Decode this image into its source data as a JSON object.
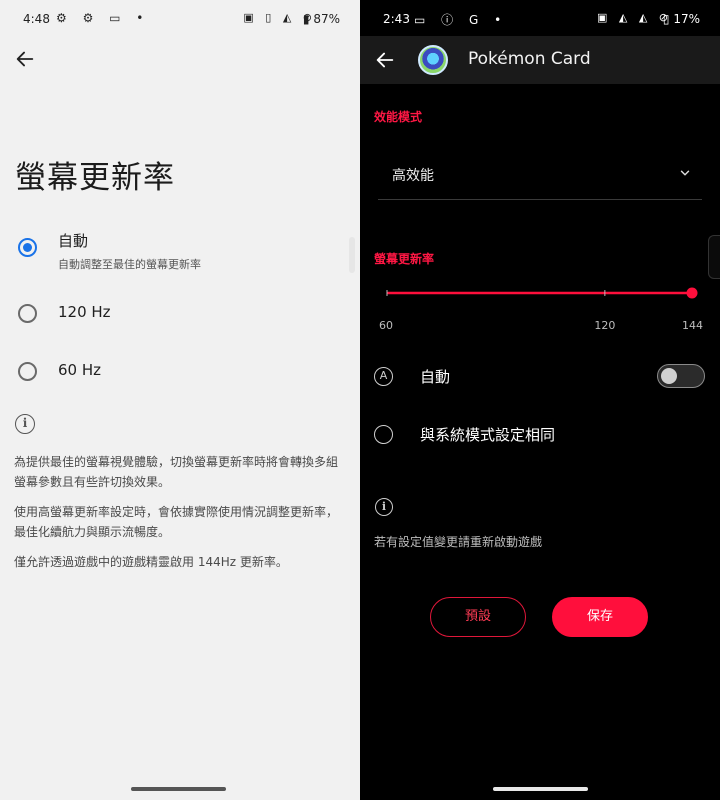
{
  "left": {
    "status": {
      "time": "4:48",
      "icons_left": "⚙ ⚙ ▭ •",
      "icons_right": "▣ ▯ ◭ ⊘",
      "battery": "▮ 87%"
    },
    "title": "螢幕更新率",
    "options": [
      {
        "label": "自動",
        "sublabel": "自動調整至最佳的螢幕更新率",
        "selected": true
      },
      {
        "label": "120 Hz",
        "sublabel": "",
        "selected": false
      },
      {
        "label": "60 Hz",
        "sublabel": "",
        "selected": false
      }
    ],
    "info_paragraphs": [
      "為提供最佳的螢幕視覺體驗，切換螢幕更新率時將會轉換多組螢幕參數且有些許切換效果。",
      "使用高螢幕更新率設定時，會依據實際使用情況調整更新率，最佳化續航力與顯示流暢度。",
      "僅允許透過遊戲中的遊戲精靈啟用 144Hz 更新率。"
    ]
  },
  "right": {
    "status": {
      "time": "2:43",
      "icons_left": "▭ ⓘ G •",
      "icons_right": "▣ ◭ ◭ ⊘",
      "battery": "▯ 17%"
    },
    "app_title": "Pokémon Card",
    "performance": {
      "label": "效能模式",
      "value": "高效能"
    },
    "refresh": {
      "label": "螢幕更新率",
      "ticks": [
        "60",
        "120",
        "144"
      ],
      "min": 60,
      "max": 144,
      "value": 144,
      "accent": "#ff0f3c"
    },
    "auto_label": "自動",
    "auto_on": false,
    "same_as_system_label": "與系統模式設定相同",
    "note": "若有設定值變更請重新啟動遊戲",
    "buttons": {
      "default": "預設",
      "save": "保存"
    }
  }
}
